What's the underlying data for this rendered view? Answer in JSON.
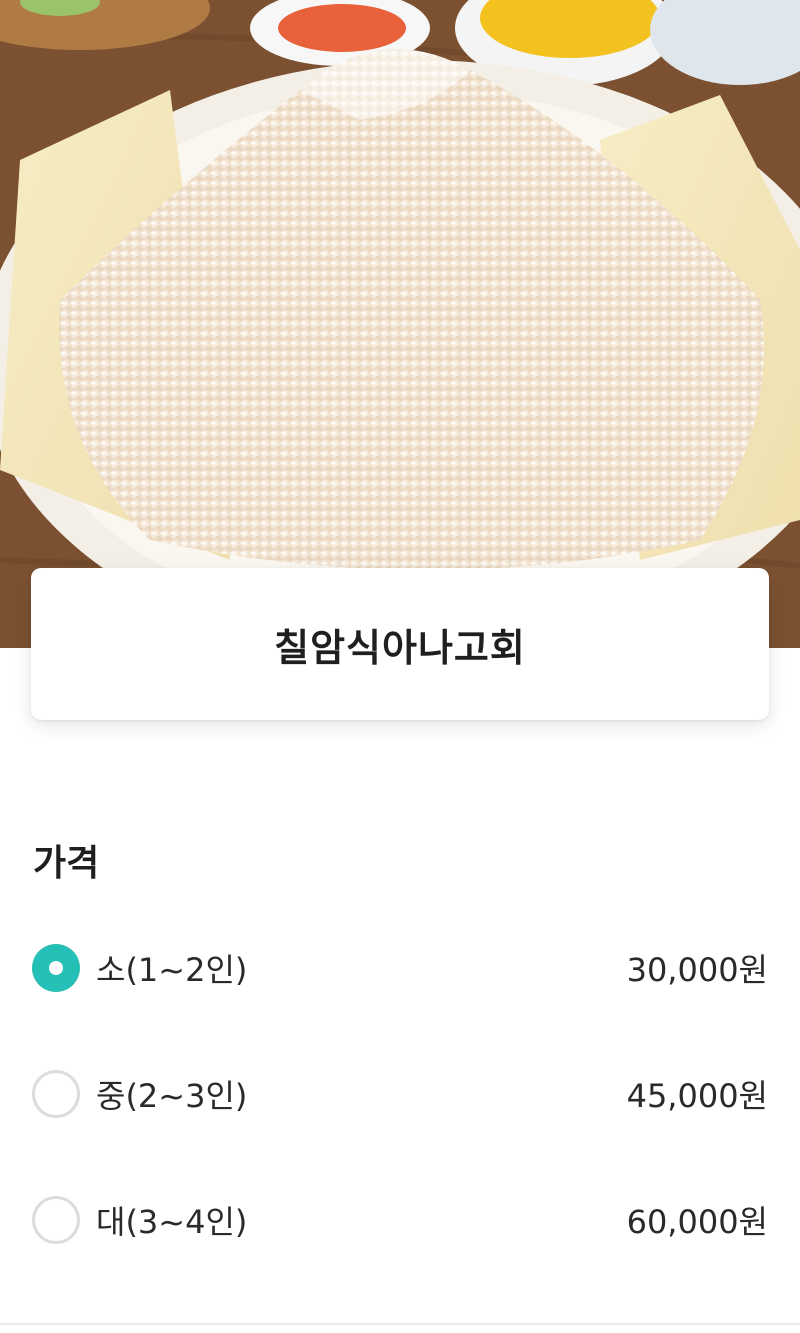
{
  "menu": {
    "title": "칠암식아나고회",
    "photo_icon": "food-photo"
  },
  "price_section": {
    "title": "가격",
    "options": [
      {
        "label": "소(1~2인)",
        "price": "30,000원",
        "selected": true
      },
      {
        "label": "중(2~3인)",
        "price": "45,000원",
        "selected": false
      },
      {
        "label": "대(3~4인)",
        "price": "60,000원",
        "selected": false
      }
    ]
  },
  "colors": {
    "accent": "#26bfb5",
    "radio_border": "#dcdcdc",
    "text": "#222222"
  }
}
